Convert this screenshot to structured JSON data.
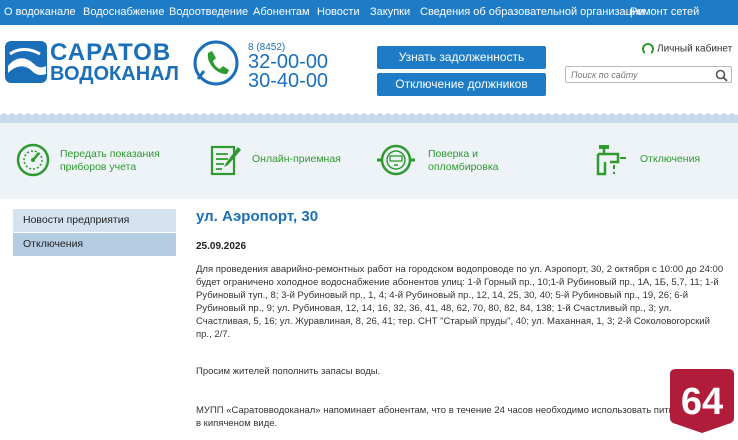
{
  "topnav": {
    "items": [
      "О водоканале",
      "Водоснабжение",
      "Водоотведение",
      "Абонентам",
      "Новости",
      "Закупки",
      "Сведения об образовательной организации",
      "Ремонт сетей"
    ]
  },
  "header": {
    "logo_line1": "САРАТОВ",
    "logo_line2": "ВОДОКАНАЛ",
    "phone_code": "8 (8452)",
    "phone1": "32-00-00",
    "phone2": "30-40-00",
    "btn_debt": "Узнать задолженность",
    "btn_debtors": "Отключение должников",
    "cabinet": "Личный кабинет",
    "search_placeholder": "Поиск по сайту"
  },
  "services": {
    "items": [
      {
        "line1": "Передать показания",
        "line2": "приборов учета",
        "icon": "meter-gauge-icon"
      },
      {
        "line1": "Онлайн-приемная",
        "line2": "",
        "icon": "online-form-icon"
      },
      {
        "line1": "Поверка и",
        "line2": "опломбировка",
        "icon": "water-meter-icon"
      },
      {
        "line1": "Отключения",
        "line2": "",
        "icon": "faucet-icon"
      }
    ]
  },
  "sidebar": {
    "items": [
      "Новости предприятия",
      "Отключения"
    ]
  },
  "article": {
    "title": "ул. Аэропорт, 30",
    "date": "25.09.2026",
    "p1": "Для проведения аварийно-ремонтных работ на городском водопроводе по ул. Аэропорт, 30, 2 октября с 10:00 до 24:00 будет ограничено холодное водоснабжение абонентов улиц: 1-й Горный пр., 10;1-й Рубиновый пр., 1А, 1Б, 5,7, 11; 1-й Рубиновый туп., 8; 3-й Рубиновый пр., 1, 4; 4-й Рубиновый пр., 12, 14, 25, 30, 40; 5-й Рубиновый пр., 19, 26; 6-й Рубиновый пр., 9; ул. Рубиновая, 12, 14, 16, 32, 36, 41, 48, 62, 70, 80, 82, 84, 138; 1-й Счастливый пр., 3; ул. Счастливая, 5, 16; ул. Журавлиная, 8, 26, 41; тер. СНТ \"Старый пруды\", 40; ул. Маханная, 1, 3; 2-й Соколовогорский пр., 2/7.",
    "p2": "Просим жителей пополнить запасы воды.",
    "p3": "МУПП «Саратовводоканал» напоминает абонентам, что в течение 24 часов необходимо использовать питьевую воду в кипяченом виде."
  },
  "badge": {
    "text": "64"
  },
  "colors": {
    "brand_blue": "#1e7cc6",
    "accent_green": "#2f9a2f",
    "badge_red": "#b01c3a"
  }
}
